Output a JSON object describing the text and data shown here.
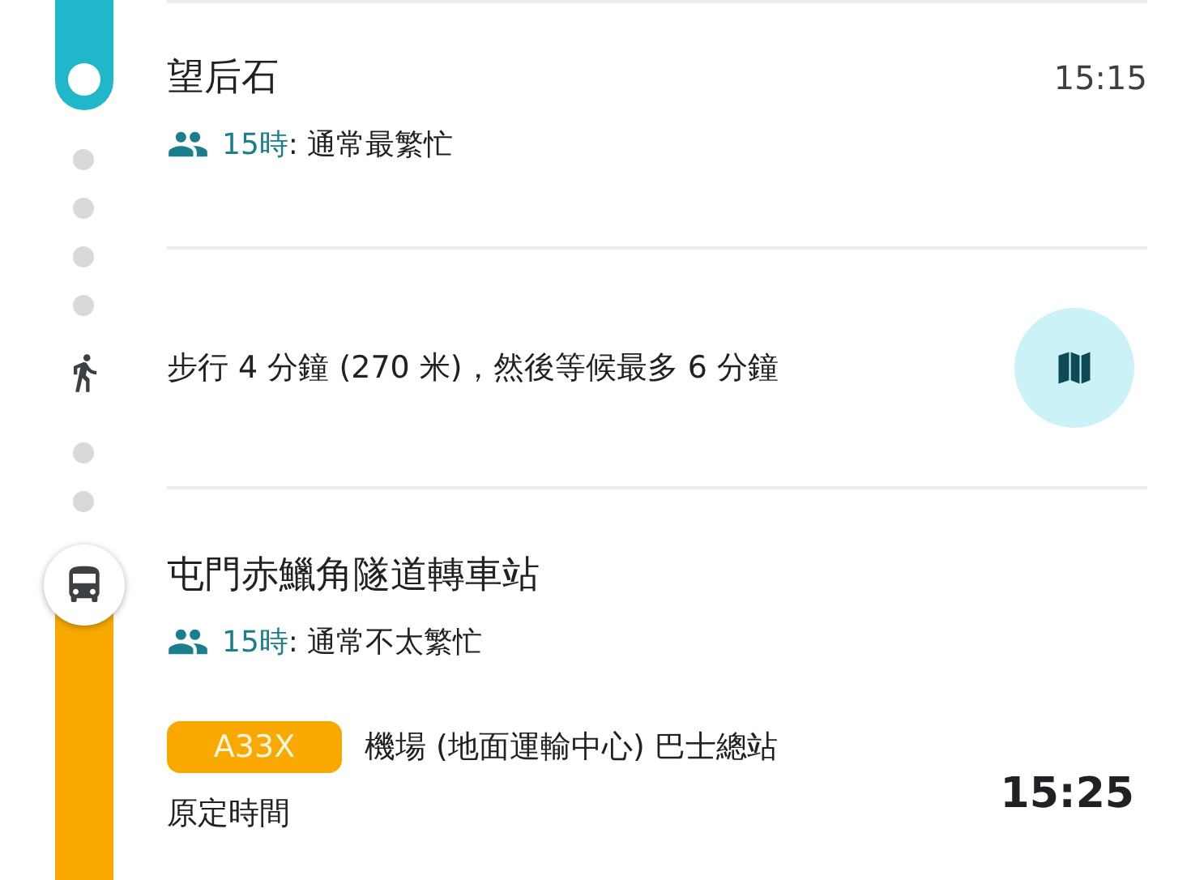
{
  "first_stop": {
    "name": "望后石",
    "time": "15:15",
    "crowd_hour": "15時",
    "crowd_text": ": 通常最繁忙"
  },
  "walk": {
    "text": "步行 4 分鐘 (270 米)，然後等候最多 6 分鐘"
  },
  "boarding_stop": {
    "name": "屯門赤鱲角隧道轉車站",
    "crowd_hour": "15時",
    "crowd_text": ": 通常不太繁忙",
    "route": {
      "badge": "A33X",
      "color": "#f9a800",
      "destination": "機場 (地面運輸中心) 巴士總站"
    },
    "schedule_label": "原定時間",
    "departure_time": "15:25"
  }
}
